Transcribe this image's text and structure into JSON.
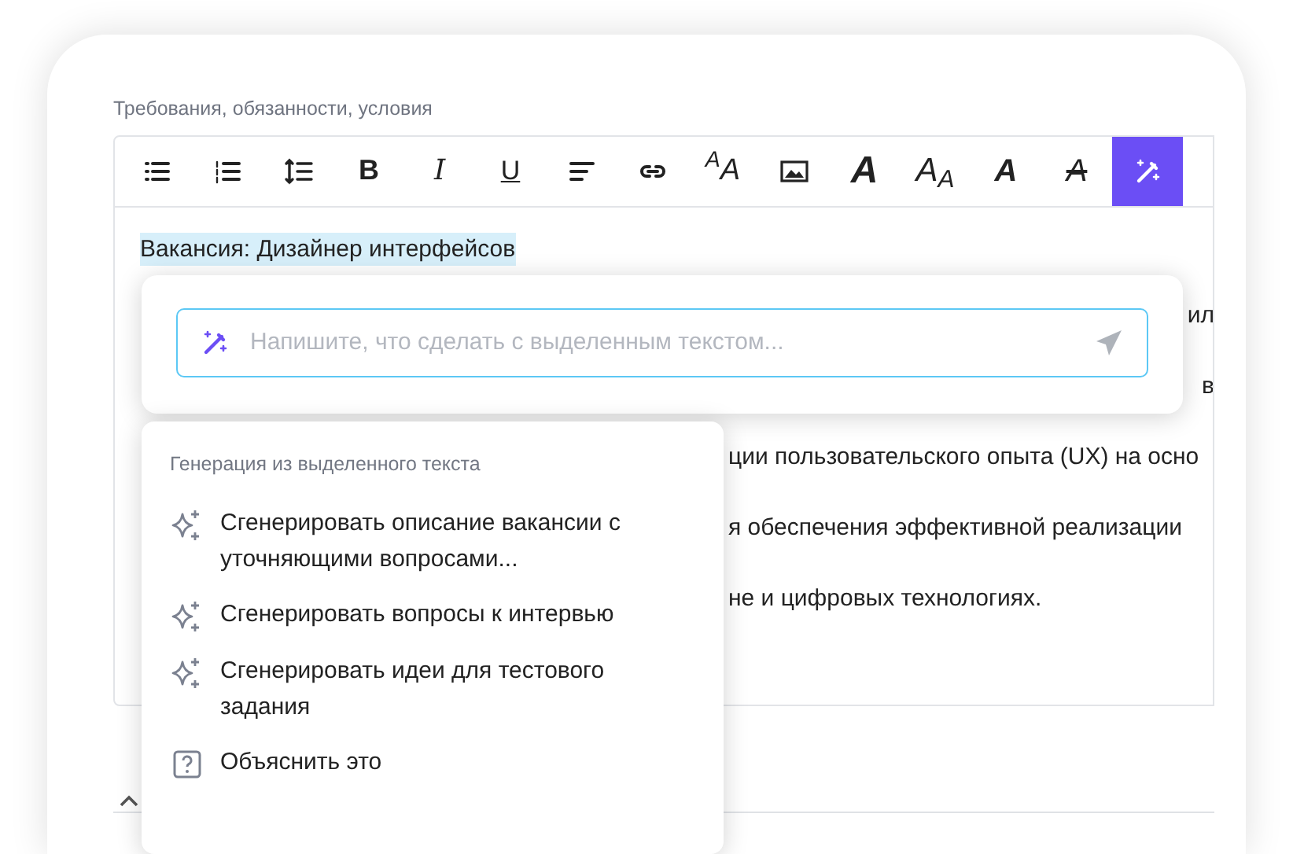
{
  "field": {
    "label": "Требования, обязанности, условия"
  },
  "toolbar": [
    {
      "kind": "bullet-list",
      "selected": false
    },
    {
      "kind": "numbered-list",
      "selected": false
    },
    {
      "kind": "line-spacing",
      "selected": false
    },
    {
      "kind": "bold",
      "label": "B",
      "selected": false
    },
    {
      "kind": "italic",
      "label": "I",
      "selected": false
    },
    {
      "kind": "underline",
      "label": "U",
      "selected": false
    },
    {
      "kind": "align-left",
      "selected": false
    },
    {
      "kind": "link",
      "selected": false
    },
    {
      "kind": "font-size",
      "label": "$^{A}$A",
      "selected": false
    },
    {
      "kind": "image",
      "selected": false
    },
    {
      "kind": "font",
      "label": "A",
      "selected": false
    },
    {
      "kind": "font-case",
      "label": "A$_{A}$",
      "selected": false
    },
    {
      "kind": "font-color",
      "label": "A",
      "selected": false
    },
    {
      "kind": "clear-format",
      "label": "A",
      "selected": false
    },
    {
      "kind": "magic",
      "selected": true
    }
  ],
  "editor": {
    "selected_text": "Вакансия: Дизайнер интерфейсов",
    "lines": [
      {
        "kind": "tail",
        "text": "ил"
      },
      {
        "kind": "tail",
        "text": "в"
      },
      {
        "kind": "fragment",
        "text": "ции пользовательского опыта (UX) на осно"
      },
      {
        "kind": "fragment",
        "text": "я обеспечения эффективной реализации"
      },
      {
        "kind": "fragment",
        "text": "не и цифровых технологиях."
      }
    ]
  },
  "prompt": {
    "placeholder": "Напишите, что сделать с выделенным текстом..."
  },
  "menu": {
    "sections": [
      {
        "title": "Генерация из выделенного текста",
        "items": [
          {
            "kind": "sparkle",
            "text": "Сгенерировать описание вакансии с уточняющими вопросами..."
          },
          {
            "kind": "sparkle",
            "text": "Сгенерировать вопросы к интервью"
          },
          {
            "kind": "sparkle",
            "text": "Сгенерировать идеи для тестового задания"
          },
          {
            "kind": "question",
            "text": "Объяснить это"
          }
        ]
      }
    ]
  }
}
